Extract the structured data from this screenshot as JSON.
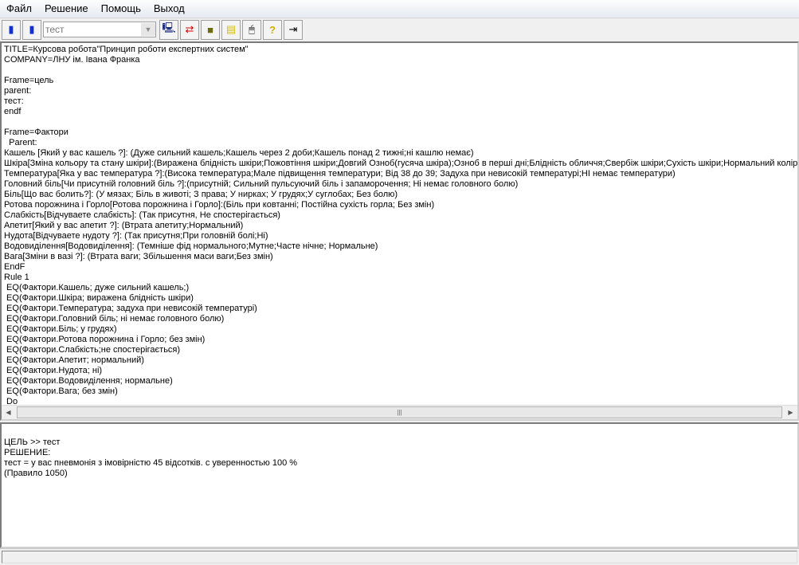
{
  "menu": [
    "Файл",
    "Решение",
    "Помощь",
    "Выход"
  ],
  "toolbar": {
    "combo_value": "тест",
    "icons": [
      "open-book-icon",
      "book-icon",
      "computer-icon",
      "swap-arrows-icon",
      "binder-icon",
      "notes-icon",
      "mouse-icon",
      "help-icon",
      "exit-icon"
    ]
  },
  "editor_lines": [
    "TITLE=Курсова робота\"Принцип роботи експертних систем\"",
    "COMPANY=ЛНУ ім. Івана Франка",
    "",
    "Frame=цель",
    "parent:",
    "тест:",
    "endf",
    "",
    "Frame=Фактори",
    "  Parent:",
    "Кашель [Який у вас кашель ?]: (Дуже сильний кашель;Кашель через 2 доби;Кашель понад 2 тижні;ні кашлю немає)",
    "Шкіра[Зміна кольору та стану шкіри]:(Виражена блідність шкіри;Пожовтіння шкіри;Довгий Озноб(гусяча шкіра);Озноб в перші дні;Блідність обличчя;Свербіж шкіри;Сухість шкіри;Нормальний колір шкіри)",
    "Температура[Яка у вас температура ?]:(Висока температура;Мале підвищення температури; Від 38 до 39; Задуха при невисокій температурі;НІ немає температури)",
    "Головний біль[Чи присутній головний біль ?]:(присутній; Сильний пульсуючий біль і запаморочення; Ні немає головного болю)",
    "Біль[Що вас болить?]: (У мязах; Біль в животі; З права; У нирках; У грудях;У суглобах; Без болю)",
    "Ротова порожнина і Горло[Ротова порожнина і Горло]:(Біль при ковтанні; Постійна сухість горла; Без змін)",
    "Слабкість[Відчуваете слабкість]: (Так присутня, Не спостерігається)",
    "Апетит[Який у вас апетит ?]: (Втрата апетиту;Нормальний)",
    "Нудота[Відчуваете нудоту ?]: (Так присутня;При головній болі;Ні)",
    "Водовиділення[Водовиділення]: (Темніше фід нормального;Мутне;Часте нічне; Нормальне)",
    "Вага[Зміни в вазі ?]: (Втрата ваги; Збільшення маси ваги;Без змін)",
    "EndF",
    "Rule 1",
    " EQ(Фактори.Кашель; дуже сильний кашель;)",
    " EQ(Фактори.Шкіра; виражена блідність шкіри)",
    " EQ(Фактори.Температура; задуха при невисокій температурі)",
    " EQ(Фактори.Головний біль; ні немає головного болю)",
    " EQ(Фактори.Біль; у грудях)",
    " EQ(Фактори.Ротова порожнина і Горло; без змін)",
    " EQ(Фактори.Слабкість;не спостерігається)",
    " EQ(Фактори.Апетит; нормальний)",
    " EQ(Фактори.Нудота; ні)",
    " EQ(Фактори.Водовиділення; нормальне)",
    " EQ(Фактори.Вага; без змін)",
    " Do"
  ],
  "output_lines": [
    "ЦЕЛЬ >> тест",
    "РЕШЕНИЕ:",
    "тест = у вас пневмонія з імовірністю 45 відсотків. с уверенностью 100 %",
    "(Правило 1050)"
  ]
}
